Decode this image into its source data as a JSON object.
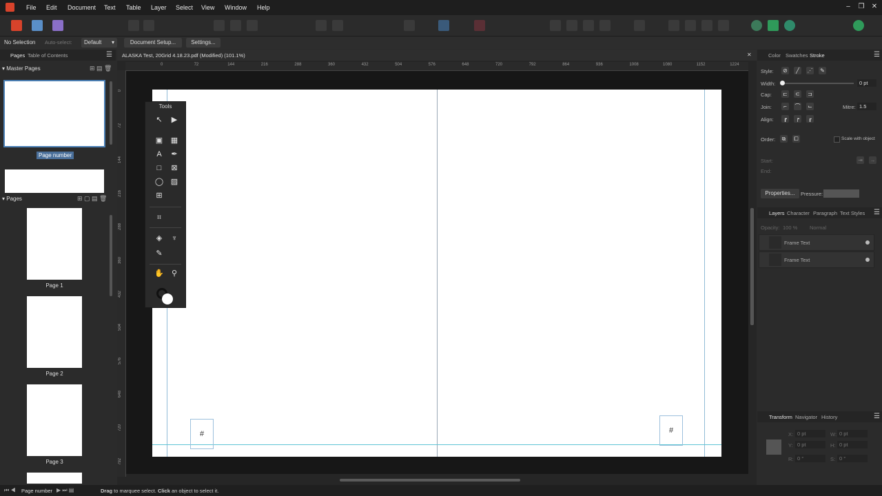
{
  "menu": {
    "app_icon": "affinity-publisher-icon",
    "items": [
      "File",
      "Edit",
      "Document",
      "Text",
      "Table",
      "Layer",
      "Select",
      "View",
      "Window",
      "Help"
    ],
    "window_controls": [
      "–",
      "❐",
      "✕"
    ]
  },
  "context_bar": {
    "selection": "No Selection",
    "auto_select_label": "Auto-select:",
    "auto_select_value": "Default",
    "document_setup": "Document Setup...",
    "settings": "Settings..."
  },
  "left_panel": {
    "tabs": [
      "Pages",
      "Table of Contents"
    ],
    "master_pages_heading": "Master Pages",
    "master_label": "Page number",
    "pages_heading": "Pages",
    "pages": [
      "Page 1",
      "Page 2",
      "Page 3"
    ]
  },
  "document": {
    "tab_title": "ALASKA Test, 20Grid 4.18.23.pdf (Modified) (101.1%)",
    "close_symbol": "✕",
    "ruler_h": [
      "0",
      "72",
      "144",
      "216",
      "288",
      "360",
      "432",
      "504",
      "576",
      "648",
      "720",
      "792",
      "864",
      "936",
      "1008",
      "1080",
      "1152",
      "1224"
    ],
    "ruler_v": [
      "0",
      "72",
      "144",
      "216",
      "288",
      "360",
      "432",
      "504",
      "576",
      "648",
      "720",
      "792"
    ],
    "frame_symbol_left": "#",
    "frame_symbol_right": "#"
  },
  "tools_panel": {
    "title": "Tools",
    "tools": [
      {
        "name": "move-tool-icon",
        "glyph": "↖"
      },
      {
        "name": "node-tool-icon",
        "glyph": "▶"
      },
      {
        "name": "frame-text-tool-icon",
        "glyph": "▣"
      },
      {
        "name": "table-tool-icon",
        "glyph": "▦"
      },
      {
        "name": "artistic-text-tool-icon",
        "glyph": "A"
      },
      {
        "name": "pen-tool-icon",
        "glyph": "✒"
      },
      {
        "name": "rectangle-tool-icon",
        "glyph": "□"
      },
      {
        "name": "picture-frame-tool-icon",
        "glyph": "⊠"
      },
      {
        "name": "ellipse-tool-icon",
        "glyph": "◯"
      },
      {
        "name": "place-image-tool-icon",
        "glyph": "▨"
      },
      {
        "name": "picture-frame-ellipse-tool-icon",
        "glyph": "⊞"
      },
      {
        "name": "crop-tool-icon",
        "glyph": "⌗"
      },
      {
        "name": "fill-tool-icon",
        "glyph": "◈"
      },
      {
        "name": "transparency-tool-icon",
        "glyph": "♆"
      },
      {
        "name": "color-picker-tool-icon",
        "glyph": "✎"
      },
      {
        "name": "hand-tool-icon",
        "glyph": "✋"
      },
      {
        "name": "zoom-tool-icon",
        "glyph": "⚲"
      }
    ]
  },
  "stroke_panel": {
    "tabs": [
      "Color",
      "Swatches",
      "Stroke"
    ],
    "style_label": "Style:",
    "width_label": "Width:",
    "width_value": "0 pt",
    "cap_label": "Cap:",
    "join_label": "Join:",
    "mitre_label": "Mitre:",
    "mitre_value": "1.5",
    "align_label": "Align:",
    "order_label": "Order:",
    "scale_with_object": "Scale with object",
    "start_label": "Start:",
    "end_label": "End:",
    "properties_button": "Properties...",
    "pressure_label": "Pressure:"
  },
  "layers_panel": {
    "tabs": [
      "Layers",
      "Character",
      "Paragraph",
      "Text Styles"
    ],
    "opacity_label": "Opacity:",
    "opacity_value": "100 %",
    "blend_mode": "Normal",
    "layers": [
      "Frame Text",
      "Frame Text"
    ]
  },
  "transform_panel": {
    "tabs": [
      "Transform",
      "Navigator",
      "History"
    ],
    "fields": [
      {
        "label": "X:",
        "value": "0 pt"
      },
      {
        "label": "W:",
        "value": "0 pt"
      },
      {
        "label": "Y:",
        "value": "0 pt"
      },
      {
        "label": "H:",
        "value": "0 pt"
      },
      {
        "label": "R:",
        "value": "0 °"
      },
      {
        "label": "S:",
        "value": "0 °"
      }
    ]
  },
  "status_bar": {
    "page_selector": "Page number",
    "hint_bold_1": "Drag",
    "hint_text_1": " to marquee select. ",
    "hint_bold_2": "Click",
    "hint_text_2": " an object to select it."
  },
  "colors": {
    "accent": "#4a7fb5",
    "guide": "#5ec4d4",
    "margin_guide": "#8fbad6"
  }
}
